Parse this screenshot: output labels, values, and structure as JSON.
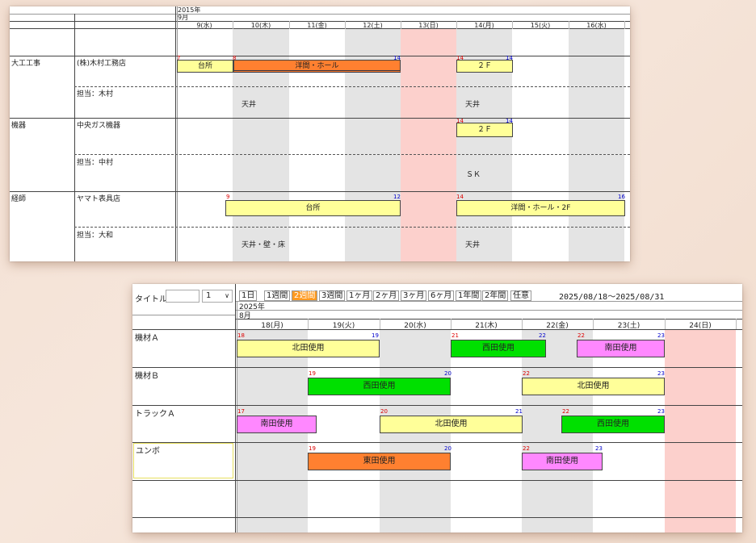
{
  "top": {
    "year": "2015年",
    "month": "9月",
    "days": [
      "9(水)",
      "10(木)",
      "11(金)",
      "12(土)",
      "13(日)",
      "14(月)",
      "15(火)",
      "16(水)"
    ],
    "groups": [
      {
        "category": "大工工事",
        "company": "(株)木村工務店",
        "person": "担当：木村"
      },
      {
        "category": "機器",
        "company": "中央ガス機器",
        "person": "担当：中村"
      },
      {
        "category": "経師",
        "company": "ヤマト表具店",
        "person": "担当：大和"
      }
    ],
    "bars": [
      {
        "label": "台所",
        "start": "7",
        "end": ""
      },
      {
        "label": "洋間・ホール",
        "start": "8",
        "end": "14"
      },
      {
        "label": "２Ｆ",
        "start": "14",
        "end": "14"
      },
      {
        "label": "２Ｆ",
        "start": "14",
        "end": "14"
      },
      {
        "label": "台所",
        "start": "9",
        "end": "12"
      },
      {
        "label": "洋間・ホール・2F",
        "start": "14",
        "end": "16"
      }
    ],
    "notes": [
      "天井",
      "天井",
      "ＳＫ",
      "天井・壁・床",
      "天井"
    ]
  },
  "bottom": {
    "title_label": "タイトル",
    "title_value": "",
    "count_value": "1",
    "tabs": [
      "1日",
      "1週間",
      "2週間",
      "3週間",
      "1ヶ月",
      "2ヶ月",
      "3ヶ月",
      "6ヶ月",
      "1年間",
      "2年間",
      "任意"
    ],
    "selected_tab": "2週間",
    "date_range": "2025/08/18～2025/08/31",
    "year": "2025年",
    "month": "8月",
    "days": [
      "18(月)",
      "19(火)",
      "20(水)",
      "21(木)",
      "22(金)",
      "23(土)",
      "24(日)"
    ],
    "rows": [
      "機材Ａ",
      "機材Ｂ",
      "トラックＡ",
      "ユンボ"
    ],
    "bars": [
      {
        "label": "北田使用",
        "start": "18",
        "end": "19",
        "color": "#ffff99"
      },
      {
        "label": "西田使用",
        "start": "21",
        "end": "22",
        "color": "#00e000"
      },
      {
        "label": "南田使用",
        "start": "22",
        "end": "23",
        "color": "#ff88ff"
      },
      {
        "label": "西田使用",
        "start": "19",
        "end": "20",
        "color": "#00e000"
      },
      {
        "label": "北田使用",
        "start": "22",
        "end": "23",
        "color": "#ffff99"
      },
      {
        "label": "南田使用",
        "start": "17",
        "end": "",
        "color": "#ff88ff"
      },
      {
        "label": "北田使用",
        "start": "20",
        "end": "21",
        "color": "#ffff99"
      },
      {
        "label": "西田使用",
        "start": "22",
        "end": "23",
        "color": "#00e000"
      },
      {
        "label": "東田使用",
        "start": "19",
        "end": "20",
        "color": "#ff8030"
      },
      {
        "label": "南田使用",
        "start": "22",
        "end": "23",
        "color": "#ff88ff"
      }
    ]
  }
}
